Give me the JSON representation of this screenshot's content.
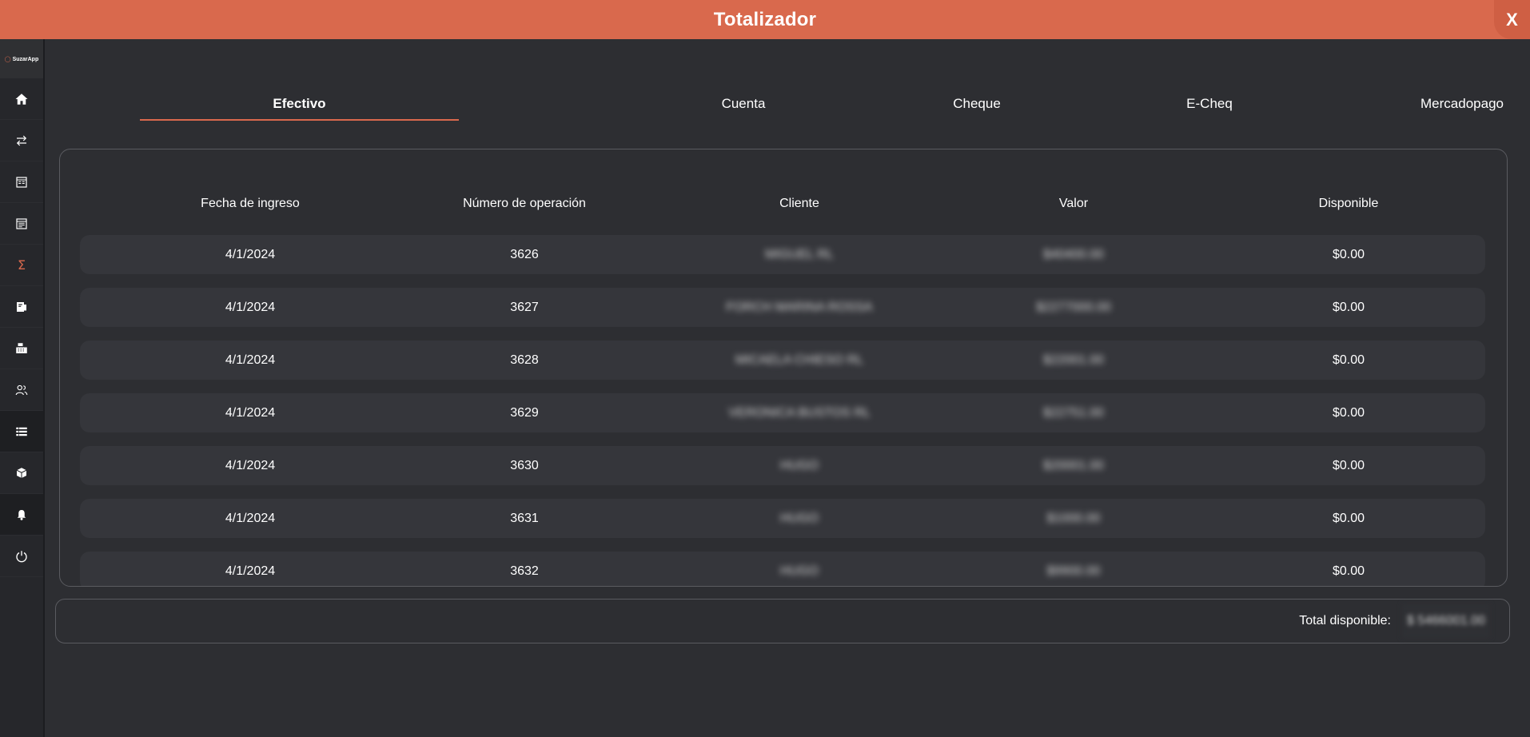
{
  "window": {
    "title": "Totalizador",
    "close_label": "X"
  },
  "sidebar": {
    "logo": "SuzarApp",
    "items": [
      {
        "icon": "home-icon",
        "dark": false
      },
      {
        "icon": "transfer-arrows-icon",
        "dark": false
      },
      {
        "icon": "receipt-icon",
        "dark": false
      },
      {
        "icon": "document-icon",
        "dark": false
      },
      {
        "icon": "sigma-icon",
        "dark": false,
        "active": true
      },
      {
        "icon": "invoice-icon",
        "dark": false
      },
      {
        "icon": "cash-register-icon",
        "dark": false
      },
      {
        "icon": "users-icon",
        "dark": false
      },
      {
        "icon": "list-icon",
        "dark": true
      },
      {
        "icon": "box-icon",
        "dark": false
      },
      {
        "icon": "bell-icon",
        "dark": true
      },
      {
        "icon": "power-icon",
        "dark": false
      }
    ]
  },
  "tabs": [
    {
      "label": "Efectivo",
      "active": true
    },
    {
      "label": "Cuenta",
      "active": false
    },
    {
      "label": "Cheque",
      "active": false
    },
    {
      "label": "E-Cheq",
      "active": false
    },
    {
      "label": "Mercadopago",
      "active": false
    }
  ],
  "table": {
    "columns": [
      "Fecha de ingreso",
      "Número de operación",
      "Cliente",
      "Valor",
      "Disponible"
    ],
    "rows": [
      {
        "fecha": "4/1/2024",
        "operacion": "3626",
        "cliente": "MIGUEL RL",
        "valor": "$40400.00",
        "disponible": "$0.00"
      },
      {
        "fecha": "4/1/2024",
        "operacion": "3627",
        "cliente": "FORCH MARINA ROSSA",
        "valor": "$2277000.00",
        "disponible": "$0.00"
      },
      {
        "fecha": "4/1/2024",
        "operacion": "3628",
        "cliente": "MICAELA CHIESO RL",
        "valor": "$22001.00",
        "disponible": "$0.00"
      },
      {
        "fecha": "4/1/2024",
        "operacion": "3629",
        "cliente": "VERONICA BUSTOS RL",
        "valor": "$22751.00",
        "disponible": "$0.00"
      },
      {
        "fecha": "4/1/2024",
        "operacion": "3630",
        "cliente": "HUGO",
        "valor": "$20001.00",
        "disponible": "$0.00"
      },
      {
        "fecha": "4/1/2024",
        "operacion": "3631",
        "cliente": "HUGO",
        "valor": "$1000.00",
        "disponible": "$0.00"
      },
      {
        "fecha": "4/1/2024",
        "operacion": "3632",
        "cliente": "HUGO",
        "valor": "$9900.00",
        "disponible": "$0.00"
      }
    ]
  },
  "total": {
    "label": "Total disponible:",
    "value": "$ 5466001.00"
  },
  "colors": {
    "accent": "#d9694d",
    "background": "#2d2e32",
    "row": "#35363b",
    "sidebar": "#26272b"
  }
}
